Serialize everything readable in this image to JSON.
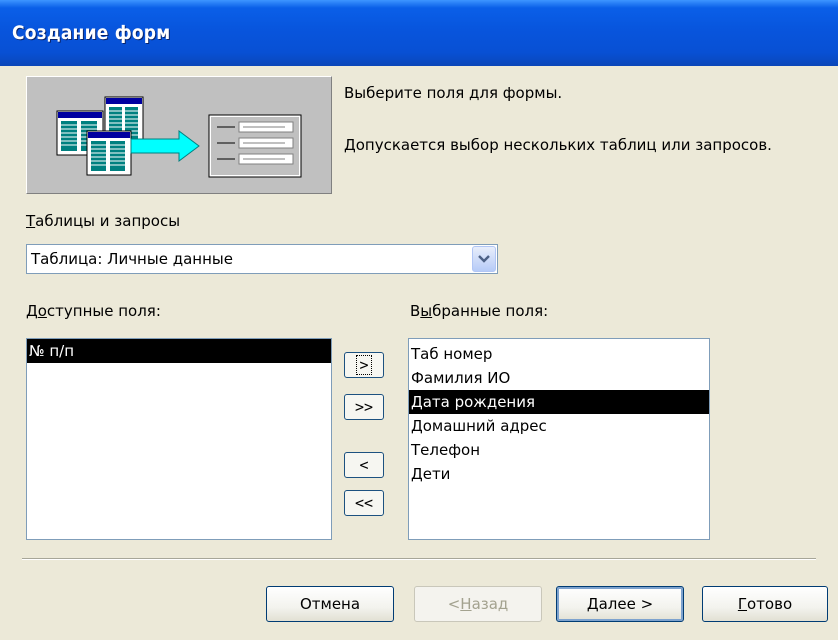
{
  "window": {
    "title": "Создание форм"
  },
  "instructions": {
    "line1": "Выберите поля для формы.",
    "line2": "Допускается выбор нескольких таблиц или запросов."
  },
  "source": {
    "label_accel": "Т",
    "label_rest": "аблицы и запросы",
    "selected": "Таблица: Личные данные"
  },
  "available": {
    "label_pre": "Д",
    "label_accel": "о",
    "label_rest": "ступные поля:",
    "items": [
      "№ п/п"
    ]
  },
  "selected_fields": {
    "label_pre": "В",
    "label_accel": "ы",
    "label_rest": "бранные поля:",
    "items": [
      "Таб номер",
      "Фамилия ИО",
      "Дата рождения",
      "Домашний адрес",
      "Телефон",
      "Дети"
    ],
    "highlighted": "Дата рождения"
  },
  "move_buttons": {
    "add_one": ">",
    "add_all": ">>",
    "remove_one": "<",
    "remove_all": "<<"
  },
  "footer": {
    "cancel": "Отмена",
    "back_prefix": "< ",
    "back_accel": "Н",
    "back_rest": "азад",
    "next_accel": "Д",
    "next_rest": "алее >",
    "finish_accel": "Г",
    "finish_rest": "отово"
  }
}
